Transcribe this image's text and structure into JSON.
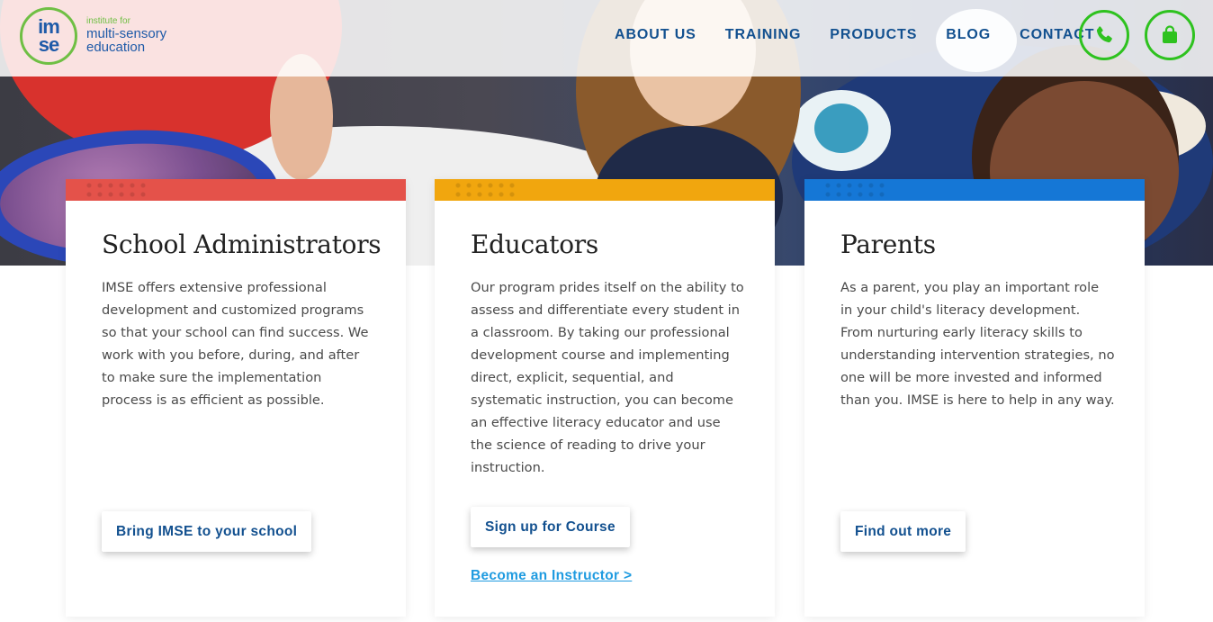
{
  "logo": {
    "mark_top": "im",
    "mark_bottom": "se",
    "line1": "institute for",
    "line2": "multi-sensory",
    "line3": "education"
  },
  "nav": {
    "items": [
      "ABOUT US",
      "TRAINING",
      "PRODUCTS",
      "BLOG",
      "CONTACT"
    ]
  },
  "header_icons": [
    "phone-icon",
    "shopping-bag-icon"
  ],
  "colors": {
    "nav_text": "#12508f",
    "accent_green": "#2ec21f",
    "band_red": "#e4524a",
    "band_yellow": "#f1a60e",
    "band_blue": "#1577d6",
    "link_blue": "#1f9be0"
  },
  "cards": [
    {
      "title": "School Administrators",
      "body": "IMSE offers extensive professional development and customized programs so that your school can find success. We work with you before, during, and after to make sure the implementation process is as efficient as possible.",
      "button": "Bring IMSE to your school"
    },
    {
      "title": "Educators",
      "body": "Our program prides itself on the ability to assess and differentiate every student in a classroom. By taking our professional development course and implementing direct, explicit, sequential, and systematic instruction, you can become an effective literacy educator and use the science of reading to drive your instruction.",
      "button": "Sign up for Course",
      "link": "Become an Instructor >"
    },
    {
      "title": "Parents",
      "body": "As a parent, you play an important role in your child's literacy development. From nurturing early literacy skills to understanding intervention strategies, no one will be more invested and informed than you. IMSE is here to help in any way.",
      "button": "Find out more"
    }
  ]
}
